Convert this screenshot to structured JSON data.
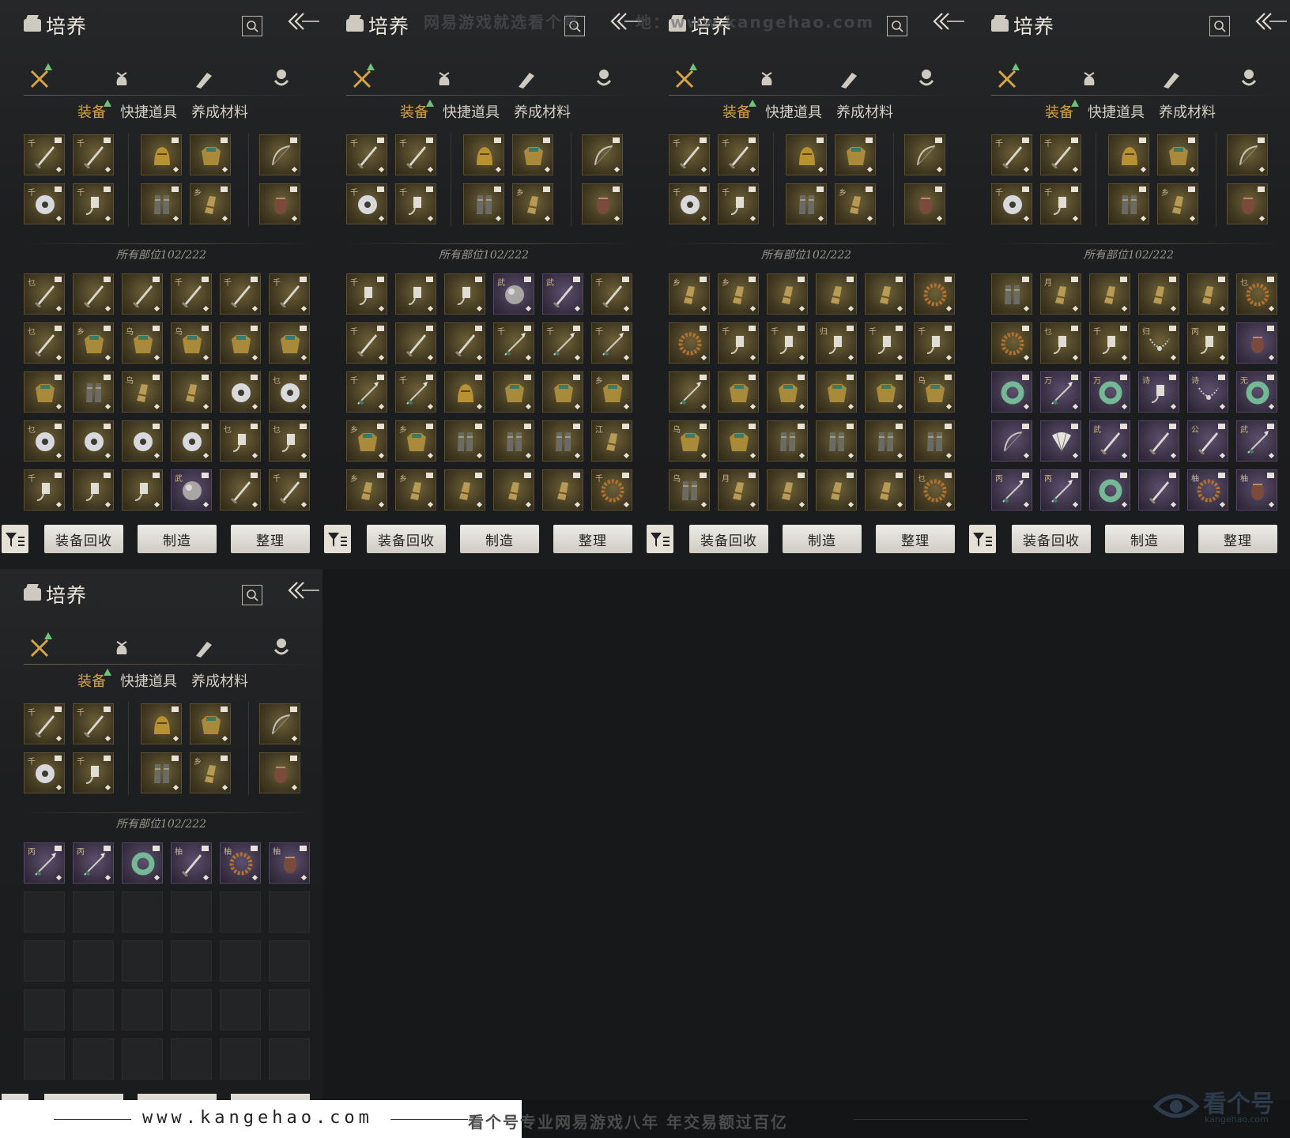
{
  "panel": {
    "title": "培养",
    "subtabs": [
      "装备",
      "快捷道具",
      "养成材料"
    ],
    "category_icons": [
      "crossed-swords-icon",
      "pouch-icon",
      "scroll-icon",
      "gem-icon"
    ],
    "count_label": "所有部位",
    "count_value": "102/222",
    "buttons": {
      "recycle": "装备回收",
      "craft": "制造",
      "sort": "整理"
    }
  },
  "watermarks": {
    "top": "网易游戏就选看个号",
    "top2": "地：www.kangehao.com",
    "footer_url": "www.kangehao.com",
    "footer_slogan": "看个号专业网易游戏八年  年交易额过百亿",
    "logo_name": "看个号",
    "logo_sub": "kangehao.com"
  },
  "equipped": {
    "row1": [
      {
        "tag": "千",
        "art": "sword"
      },
      {
        "tag": "千",
        "art": "sword"
      },
      {
        "tag": "",
        "art": "helmet"
      },
      {
        "tag": "",
        "art": "armor"
      },
      {
        "tag": "",
        "art": "bow"
      }
    ],
    "row2": [
      {
        "tag": "千",
        "art": "ring"
      },
      {
        "tag": "千",
        "art": "charm"
      },
      {
        "tag": "",
        "art": "greaves"
      },
      {
        "tag": "乡",
        "art": "vambrace"
      },
      {
        "tag": "",
        "art": "pouch"
      }
    ]
  },
  "inventory_pages": [
    [
      {
        "tag": "乜",
        "art": "sword",
        "q": "gold"
      },
      {
        "tag": "",
        "art": "sword",
        "q": "gold"
      },
      {
        "tag": "",
        "art": "sword",
        "q": "gold"
      },
      {
        "tag": "千",
        "art": "sword",
        "q": "gold"
      },
      {
        "tag": "千",
        "art": "sword",
        "q": "gold"
      },
      {
        "tag": "千",
        "art": "sword",
        "q": "gold"
      },
      {
        "tag": "乜",
        "art": "sword",
        "q": "gold"
      },
      {
        "tag": "乡",
        "art": "armor",
        "q": "gold"
      },
      {
        "tag": "乌",
        "art": "armor",
        "q": "gold"
      },
      {
        "tag": "乌",
        "art": "armor",
        "q": "gold"
      },
      {
        "tag": "",
        "art": "armor",
        "q": "gold"
      },
      {
        "tag": "",
        "art": "armor",
        "q": "gold"
      },
      {
        "tag": "",
        "art": "armor",
        "q": "gold"
      },
      {
        "tag": "",
        "art": "greaves",
        "q": "gold"
      },
      {
        "tag": "乌",
        "art": "vambrace",
        "q": "gold"
      },
      {
        "tag": "",
        "art": "vambrace",
        "q": "gold"
      },
      {
        "tag": "",
        "art": "ring",
        "q": "gold"
      },
      {
        "tag": "乜",
        "art": "ring",
        "q": "gold"
      },
      {
        "tag": "乜",
        "art": "ring",
        "q": "gold"
      },
      {
        "tag": "",
        "art": "ring",
        "q": "gold"
      },
      {
        "tag": "",
        "art": "ring",
        "q": "gold"
      },
      {
        "tag": "",
        "art": "ring",
        "q": "gold"
      },
      {
        "tag": "乜",
        "art": "charm",
        "q": "gold"
      },
      {
        "tag": "乜",
        "art": "charm",
        "q": "gold"
      },
      {
        "tag": "千",
        "art": "charm",
        "q": "gold"
      },
      {
        "tag": "",
        "art": "charm",
        "q": "gold"
      },
      {
        "tag": "",
        "art": "charm",
        "q": "gold"
      },
      {
        "tag": "武",
        "art": "orb",
        "q": "purple"
      },
      {
        "tag": "",
        "art": "sword",
        "q": "gold"
      },
      {
        "tag": "千",
        "art": "sword",
        "q": "gold"
      }
    ],
    [
      {
        "tag": "千",
        "art": "charm",
        "q": "gold"
      },
      {
        "tag": "",
        "art": "charm",
        "q": "gold"
      },
      {
        "tag": "",
        "art": "charm",
        "q": "gold"
      },
      {
        "tag": "武",
        "art": "orb",
        "q": "purple"
      },
      {
        "tag": "武",
        "art": "sword",
        "q": "purple"
      },
      {
        "tag": "千",
        "art": "sword",
        "q": "gold"
      },
      {
        "tag": "千",
        "art": "sword",
        "q": "gold"
      },
      {
        "tag": "",
        "art": "sword",
        "q": "gold"
      },
      {
        "tag": "",
        "art": "sword",
        "q": "gold"
      },
      {
        "tag": "千",
        "art": "spear",
        "q": "gold"
      },
      {
        "tag": "千",
        "art": "spear",
        "q": "gold"
      },
      {
        "tag": "千",
        "art": "spear",
        "q": "gold"
      },
      {
        "tag": "千",
        "art": "spear",
        "q": "gold"
      },
      {
        "tag": "千",
        "art": "spear",
        "q": "gold"
      },
      {
        "tag": "",
        "art": "helmet",
        "q": "gold"
      },
      {
        "tag": "",
        "art": "armor",
        "q": "gold"
      },
      {
        "tag": "",
        "art": "armor",
        "q": "gold"
      },
      {
        "tag": "乡",
        "art": "armor",
        "q": "gold"
      },
      {
        "tag": "乡",
        "art": "armor",
        "q": "gold"
      },
      {
        "tag": "乡",
        "art": "armor",
        "q": "gold"
      },
      {
        "tag": "",
        "art": "greaves",
        "q": "gold"
      },
      {
        "tag": "",
        "art": "greaves",
        "q": "gold"
      },
      {
        "tag": "",
        "art": "greaves",
        "q": "gold"
      },
      {
        "tag": "江",
        "art": "vambrace",
        "q": "gold"
      },
      {
        "tag": "乡",
        "art": "vambrace",
        "q": "gold"
      },
      {
        "tag": "乡",
        "art": "vambrace",
        "q": "gold"
      },
      {
        "tag": "",
        "art": "vambrace",
        "q": "gold"
      },
      {
        "tag": "",
        "art": "vambrace",
        "q": "gold"
      },
      {
        "tag": "",
        "art": "vambrace",
        "q": "gold"
      },
      {
        "tag": "千",
        "art": "bead",
        "q": "gold"
      }
    ],
    [
      {
        "tag": "乡",
        "art": "vambrace",
        "q": "gold"
      },
      {
        "tag": "乡",
        "art": "vambrace",
        "q": "gold"
      },
      {
        "tag": "",
        "art": "vambrace",
        "q": "gold"
      },
      {
        "tag": "",
        "art": "vambrace",
        "q": "gold"
      },
      {
        "tag": "",
        "art": "vambrace",
        "q": "gold"
      },
      {
        "tag": "",
        "art": "bead",
        "q": "gold"
      },
      {
        "tag": "",
        "art": "bead",
        "q": "gold"
      },
      {
        "tag": "千",
        "art": "charm",
        "q": "gold"
      },
      {
        "tag": "千",
        "art": "charm",
        "q": "gold"
      },
      {
        "tag": "归",
        "art": "charm",
        "q": "gold"
      },
      {
        "tag": "千",
        "art": "charm",
        "q": "gold"
      },
      {
        "tag": "千",
        "art": "charm",
        "q": "gold"
      },
      {
        "tag": "",
        "art": "spear",
        "q": "gold"
      },
      {
        "tag": "",
        "art": "armor",
        "q": "gold"
      },
      {
        "tag": "",
        "art": "armor",
        "q": "gold"
      },
      {
        "tag": "",
        "art": "armor",
        "q": "gold"
      },
      {
        "tag": "",
        "art": "armor",
        "q": "gold"
      },
      {
        "tag": "乌",
        "art": "armor",
        "q": "gold"
      },
      {
        "tag": "乌",
        "art": "armor",
        "q": "gold"
      },
      {
        "tag": "",
        "art": "armor",
        "q": "gold"
      },
      {
        "tag": "",
        "art": "greaves",
        "q": "gold"
      },
      {
        "tag": "",
        "art": "greaves",
        "q": "gold"
      },
      {
        "tag": "",
        "art": "greaves",
        "q": "gold"
      },
      {
        "tag": "",
        "art": "greaves",
        "q": "gold"
      },
      {
        "tag": "乌",
        "art": "greaves",
        "q": "gold"
      },
      {
        "tag": "月",
        "art": "vambrace",
        "q": "gold"
      },
      {
        "tag": "",
        "art": "vambrace",
        "q": "gold"
      },
      {
        "tag": "",
        "art": "vambrace",
        "q": "gold"
      },
      {
        "tag": "",
        "art": "vambrace",
        "q": "gold"
      },
      {
        "tag": "乜",
        "art": "bead",
        "q": "gold"
      }
    ],
    [
      {
        "tag": "",
        "art": "greaves",
        "q": "gold"
      },
      {
        "tag": "月",
        "art": "vambrace",
        "q": "gold"
      },
      {
        "tag": "",
        "art": "vambrace",
        "q": "gold"
      },
      {
        "tag": "",
        "art": "vambrace",
        "q": "gold"
      },
      {
        "tag": "",
        "art": "vambrace",
        "q": "gold"
      },
      {
        "tag": "乜",
        "art": "bead",
        "q": "gold"
      },
      {
        "tag": "",
        "art": "bead",
        "q": "gold"
      },
      {
        "tag": "乜",
        "art": "charm",
        "q": "gold"
      },
      {
        "tag": "千",
        "art": "charm",
        "q": "gold"
      },
      {
        "tag": "归",
        "art": "necklace",
        "q": "gold"
      },
      {
        "tag": "丙",
        "art": "charm",
        "q": "gold"
      },
      {
        "tag": "",
        "art": "pouch",
        "q": "purple"
      },
      {
        "tag": "",
        "art": "jade",
        "q": "purple"
      },
      {
        "tag": "万",
        "art": "spear",
        "q": "purple"
      },
      {
        "tag": "万",
        "art": "jade",
        "q": "purple"
      },
      {
        "tag": "诗",
        "art": "charm",
        "q": "purple"
      },
      {
        "tag": "诗",
        "art": "necklace",
        "q": "purple"
      },
      {
        "tag": "无",
        "art": "jade",
        "q": "purple"
      },
      {
        "tag": "",
        "art": "bow",
        "q": "purple"
      },
      {
        "tag": "",
        "art": "fan",
        "q": "purple"
      },
      {
        "tag": "武",
        "art": "sword",
        "q": "purple"
      },
      {
        "tag": "",
        "art": "sword",
        "q": "purple"
      },
      {
        "tag": "公",
        "art": "sword",
        "q": "purple"
      },
      {
        "tag": "武",
        "art": "spear",
        "q": "purple"
      },
      {
        "tag": "丙",
        "art": "spear",
        "q": "purple"
      },
      {
        "tag": "丙",
        "art": "spear",
        "q": "purple"
      },
      {
        "tag": "",
        "art": "jade",
        "q": "purple"
      },
      {
        "tag": "",
        "art": "sword",
        "q": "purple"
      },
      {
        "tag": "柚",
        "art": "bead",
        "q": "purple"
      },
      {
        "tag": "柚",
        "art": "pouch",
        "q": "purple"
      }
    ],
    [
      {
        "tag": "丙",
        "art": "spear",
        "q": "purple"
      },
      {
        "tag": "丙",
        "art": "spear",
        "q": "purple"
      },
      {
        "tag": "",
        "art": "jade",
        "q": "purple"
      },
      {
        "tag": "柚",
        "art": "sword",
        "q": "purple"
      },
      {
        "tag": "柚",
        "art": "bead",
        "q": "purple"
      },
      {
        "tag": "柚",
        "art": "pouch",
        "q": "purple"
      }
    ]
  ],
  "colors": {
    "accent": "#d8a442",
    "new_marker": "#6fc47a",
    "gold_slot": "#433a22",
    "purple_slot": "#3c3347"
  }
}
